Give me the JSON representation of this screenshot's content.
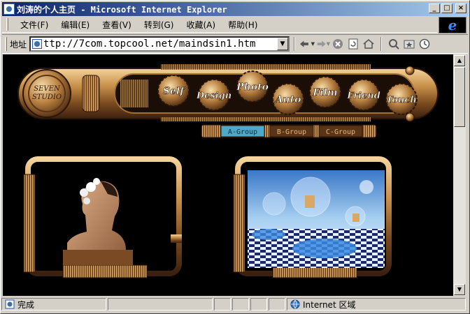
{
  "window": {
    "title": "刘涛的个人主页 - Microsoft Internet Explorer",
    "controls": {
      "minimize": "_",
      "maximize": "□",
      "close": "×"
    }
  },
  "menubar": {
    "items": [
      {
        "label": "文件(F)"
      },
      {
        "label": "编辑(E)"
      },
      {
        "label": "查看(V)"
      },
      {
        "label": "转到(G)"
      },
      {
        "label": "收藏(A)"
      },
      {
        "label": "帮助(H)"
      }
    ],
    "logo_glyph": "e"
  },
  "addressbar": {
    "label": "地址",
    "url": "ttp://7com.topcool.net/maindsin1.htm"
  },
  "toolbar": {
    "back_icon": "arrow-left-icon",
    "forward_icon": "arrow-right-icon",
    "icons": [
      "stop-icon",
      "refresh-icon",
      "home-icon",
      "search-icon",
      "favorites-icon",
      "history-icon"
    ]
  },
  "site": {
    "logo_line1": "SEVEN",
    "logo_line2": "STUDIO",
    "nav": [
      {
        "label": "Self"
      },
      {
        "label": "Design"
      },
      {
        "label": "Photo"
      },
      {
        "label": "Auto"
      },
      {
        "label": "Film"
      },
      {
        "label": "Friend"
      },
      {
        "label": "Touch"
      }
    ],
    "groups": [
      {
        "label": "A-Group",
        "active": true
      },
      {
        "label": "B-Group",
        "active": false
      },
      {
        "label": "C-Group",
        "active": false
      }
    ],
    "accent": "#c8904a",
    "active_tab": "#4fa8c8"
  },
  "statusbar": {
    "text": "完成",
    "zone": "Internet 区域"
  }
}
